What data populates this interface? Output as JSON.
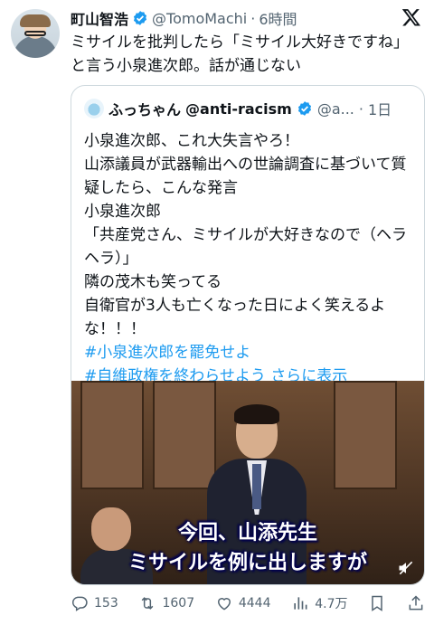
{
  "post": {
    "author_name": "町山智浩",
    "handle": "@TomoMachi",
    "separator": "·",
    "time": "6時間",
    "text": "ミサイルを批判したら「ミサイル大好きですね」と言う小泉進次郎。話が通じない"
  },
  "quote": {
    "author_name": "ふっちゃん",
    "handle_bold": "@anti-racism",
    "handle": "@a...",
    "separator": "·",
    "time": "1日",
    "lines": [
      "小泉進次郎、これ大失言やろ！",
      "山添議員が武器輸出への世論調査に基づいて質疑したら、こんな発言",
      "小泉進次郎",
      "「共産党さん、ミサイルが大好きなので（ヘラヘラ）」",
      "隣の茂木も笑ってる",
      "自衛官が3人も亡くなった日によく笑えるよな！！！"
    ],
    "hashtag1": "#小泉進次郎を罷免せよ",
    "hashtag2": "#自維政権を終わらせよう",
    "show_more": "さらに表示",
    "video": {
      "subtitle_line1": "今回、山添先生",
      "subtitle_line2": "ミサイルを例に出しますが"
    }
  },
  "actions": {
    "replies": "153",
    "reposts": "1607",
    "likes": "4444",
    "views": "4.7万"
  },
  "colors": {
    "accent": "#1d9bf0",
    "secondary_text": "#536471",
    "border": "#cfd9de"
  },
  "icons": [
    "verified-badge-icon",
    "x-logo-icon",
    "reply-icon",
    "repost-icon",
    "like-icon",
    "views-icon",
    "bookmark-icon",
    "share-icon",
    "mute-icon"
  ]
}
